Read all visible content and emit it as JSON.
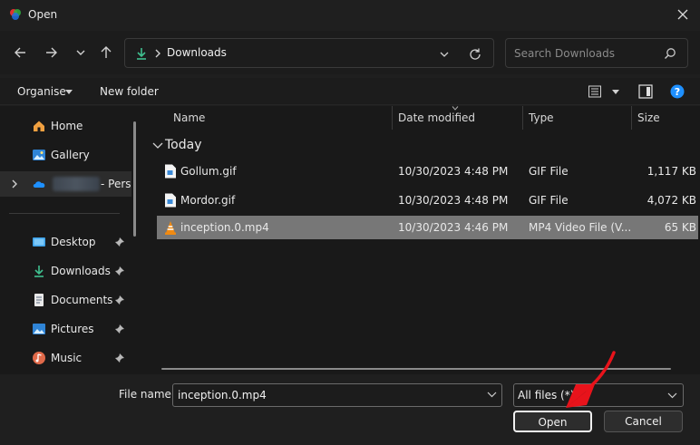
{
  "window": {
    "title": "Open"
  },
  "nav": {
    "address": "Downloads",
    "search_placeholder": "Search Downloads"
  },
  "toolbar": {
    "organise": "Organise",
    "new_folder": "New folder"
  },
  "sidebar": {
    "quick": [
      {
        "label": "Home",
        "icon": "home-icon"
      },
      {
        "label": "Gallery",
        "icon": "gallery-icon"
      }
    ],
    "onedrive_suffix": "- Pers",
    "pinned": [
      {
        "label": "Desktop",
        "icon": "desktop-icon"
      },
      {
        "label": "Downloads",
        "icon": "downloads-icon"
      },
      {
        "label": "Documents",
        "icon": "documents-icon"
      },
      {
        "label": "Pictures",
        "icon": "pictures-icon"
      },
      {
        "label": "Music",
        "icon": "music-icon"
      }
    ]
  },
  "filelist": {
    "columns": {
      "name": "Name",
      "date": "Date modified",
      "type": "Type",
      "size": "Size"
    },
    "group": "Today",
    "rows": [
      {
        "name": "Gollum.gif",
        "date": "10/30/2023 4:48 PM",
        "type": "GIF File",
        "size": "1,117 KB",
        "selected": false
      },
      {
        "name": "Mordor.gif",
        "date": "10/30/2023 4:48 PM",
        "type": "GIF File",
        "size": "4,072 KB",
        "selected": false
      },
      {
        "name": "inception.0.mp4",
        "date": "10/30/2023 4:46 PM",
        "type": "MP4 Video File (V...",
        "size": "65 KB",
        "selected": true
      }
    ]
  },
  "bottom": {
    "file_name_label": "File name:",
    "file_name_value": "inception.0.mp4",
    "file_type": "All files (*)",
    "open": "Open",
    "cancel": "Cancel"
  },
  "colors": {
    "accent": "#1e90ff",
    "selection": "#777777",
    "annotation_arrow": "#e8131b"
  }
}
